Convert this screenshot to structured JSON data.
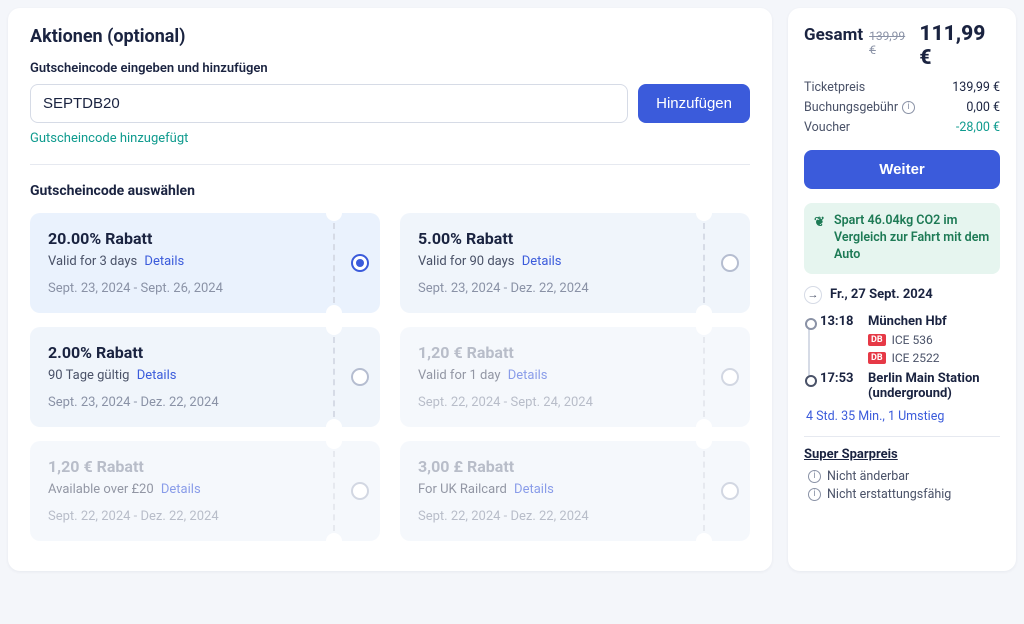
{
  "main": {
    "heading": "Aktionen (optional)",
    "input_label": "Gutscheincode eingeben und hinzufügen",
    "input_value": "SEPTDB20",
    "add_btn": "Hinzufügen",
    "success_msg": "Gutscheincode hinzugefügt",
    "select_heading": "Gutscheincode auswählen",
    "details_label": "Details"
  },
  "vouchers": [
    {
      "title": "20.00% Rabatt",
      "sub": "Valid for 3 days",
      "dates": "Sept. 23, 2024 - Sept. 26, 2024",
      "selected": true,
      "disabled": false
    },
    {
      "title": "5.00% Rabatt",
      "sub": "Valid for 90 days",
      "dates": "Sept. 23, 2024 - Dez. 22, 2024",
      "selected": false,
      "disabled": false
    },
    {
      "title": "2.00% Rabatt",
      "sub": "90 Tage gültig",
      "dates": "Sept. 23, 2024 - Dez. 22, 2024",
      "selected": false,
      "disabled": false
    },
    {
      "title": "1,20 € Rabatt",
      "sub": "Valid for 1 day",
      "dates": "Sept. 22, 2024 - Sept. 24, 2024",
      "selected": false,
      "disabled": true
    },
    {
      "title": "1,20 € Rabatt",
      "sub": "Available over £20",
      "dates": "Sept. 22, 2024 - Dez. 22, 2024",
      "selected": false,
      "disabled": true
    },
    {
      "title": "3,00 £ Rabatt",
      "sub": "For UK Railcard",
      "dates": "Sept. 22, 2024 - Dez. 22, 2024",
      "selected": false,
      "disabled": true
    }
  ],
  "summary": {
    "total_label": "Gesamt",
    "total_old": "139,99 €",
    "total_new": "111,99 €",
    "lines": {
      "ticket_label": "Ticketpreis",
      "ticket_val": "139,99 €",
      "fee_label": "Buchungsgebühr",
      "fee_val": "0,00 €",
      "voucher_label": "Voucher",
      "voucher_val": "-28,00 €"
    },
    "continue_btn": "Weiter",
    "eco_text": "Spart 46.04kg CO2 im Vergleich zur Fahrt mit dem Auto",
    "trip_date": "Fr., 27 Sept. 2024",
    "dep_time": "13:18",
    "dep_station": "München Hbf",
    "train1": "ICE 536",
    "train2": "ICE 2522",
    "arr_time": "17:53",
    "arr_station": "Berlin Main Station (underground)",
    "trip_meta": "4 Std. 35 Min., 1 Umstieg",
    "fare_name": "Super Sparpreis",
    "rule1": "Nicht änderbar",
    "rule2": "Nicht erstattungsfähig"
  }
}
